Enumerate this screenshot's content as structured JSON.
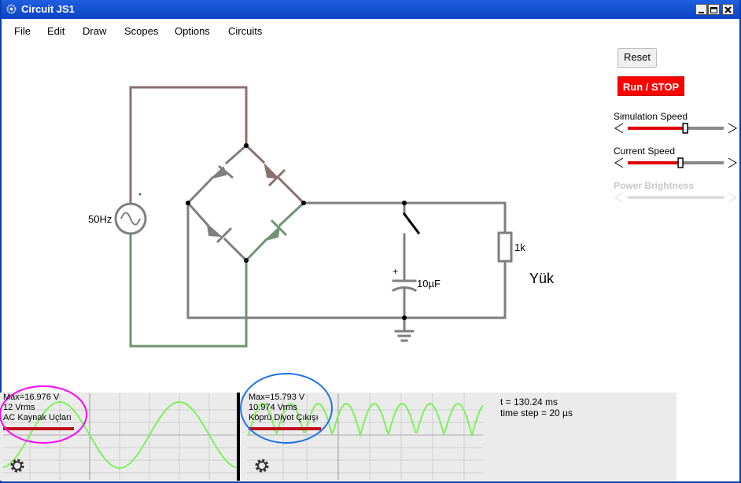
{
  "window": {
    "title": "Circuit JS1"
  },
  "menu": [
    {
      "label": "File"
    },
    {
      "label": "Edit"
    },
    {
      "label": "Draw"
    },
    {
      "label": "Scopes"
    },
    {
      "label": "Options"
    },
    {
      "label": "Circuits"
    }
  ],
  "controls": {
    "reset_label": "Reset",
    "run_label": "Run / STOP",
    "sim_speed_label": "Simulation Speed",
    "sim_speed_value": 0.6,
    "current_speed_label": "Current Speed",
    "current_speed_value": 0.55,
    "power_brightness_label": "Power Brightness",
    "power_brightness_enabled": false
  },
  "circuit": {
    "source_label": "50Hz",
    "source_marker": "*",
    "capacitor_label": "10µF",
    "capacitor_polarity": "+",
    "resistor_label": "1k",
    "load_label": "Yük"
  },
  "scopes": [
    {
      "max": "Max=16.976 V",
      "rms": "12 Vrms",
      "name": "AC Kaynak Uçları"
    },
    {
      "max": "Max=15.793 V",
      "rms": "10.974 Vrms",
      "name": "Köprü Diyot Çıkışı"
    }
  ],
  "status": {
    "time": "t = 130.24 ms",
    "time_step": "time step = 20 µs"
  },
  "colors": {
    "wire_gray": "#7f7f7f",
    "wire_green": "#6e9470",
    "wire_brown": "#8c7070",
    "trace": "#7cf25a",
    "highlight_magenta": "#ff00ff",
    "highlight_blue": "#1a73e8",
    "run_button": "#ff0000"
  }
}
